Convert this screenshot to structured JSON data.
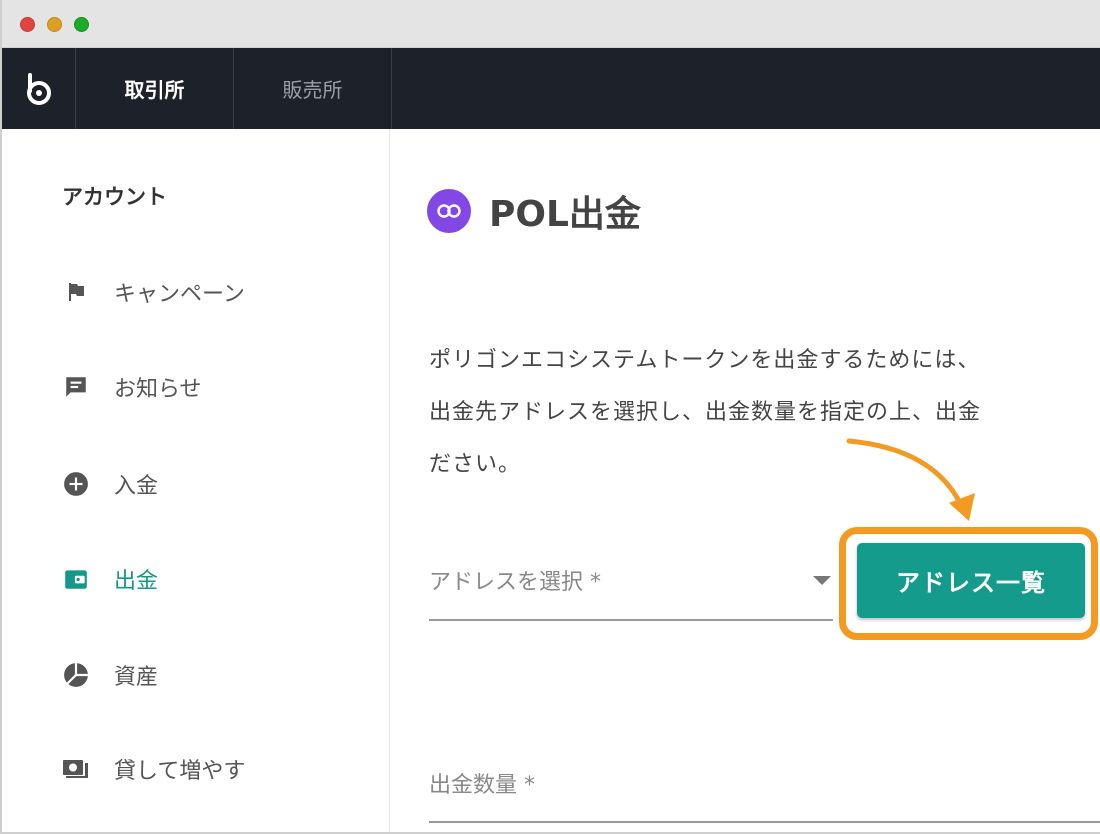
{
  "window": {
    "controls": [
      "close",
      "minimize",
      "maximize"
    ]
  },
  "topnav": {
    "logo_icon": "bitbank-logo-icon",
    "tabs": [
      {
        "label": "取引所",
        "active": true
      },
      {
        "label": "販売所",
        "active": false
      }
    ]
  },
  "sidebar": {
    "heading": "アカウント",
    "items": [
      {
        "label": "キャンペーン",
        "icon": "flag-icon",
        "active": false
      },
      {
        "label": "お知らせ",
        "icon": "message-icon",
        "active": false
      },
      {
        "label": "入金",
        "icon": "plus-circle-icon",
        "active": false
      },
      {
        "label": "出金",
        "icon": "wallet-icon",
        "active": true
      },
      {
        "label": "資産",
        "icon": "pie-chart-icon",
        "active": false
      },
      {
        "label": "貸して増やす",
        "icon": "cash-icon",
        "active": false
      }
    ]
  },
  "main": {
    "title": "POL出金",
    "title_icon": "polygon-icon",
    "description": [
      "ポリゴンエコシステムトークンを出金するためには、",
      "出金先アドレスを選択し、出金数量を指定の上、出金",
      "ださい。"
    ],
    "address_select": {
      "label": "アドレスを選択 *"
    },
    "address_list_button": "アドレス一覧",
    "quantity_field": {
      "label": "出金数量 *"
    }
  },
  "colors": {
    "accent": "#159b8c",
    "highlight": "#f39a23",
    "nav_bg": "#1d2129",
    "polygon": "#8247e5"
  }
}
